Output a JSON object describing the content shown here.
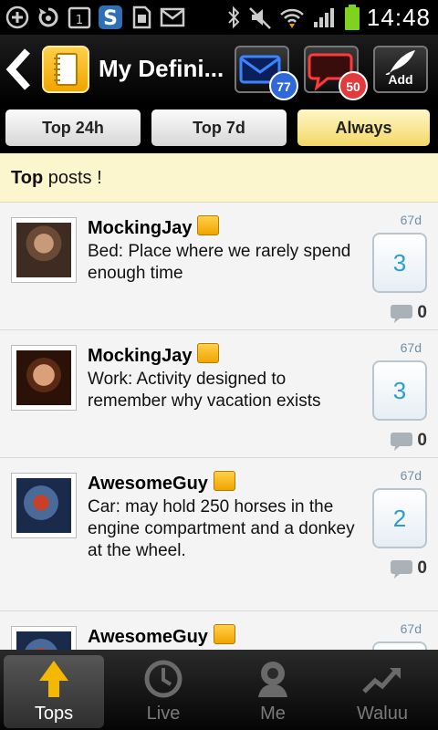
{
  "status_bar": {
    "time": "14:48",
    "icons": [
      "add-icon",
      "sync-icon",
      "calendar-icon",
      "swype-icon",
      "sim-card-icon",
      "gmail-icon",
      "bluetooth-icon",
      "mute-icon",
      "wifi-icon",
      "signal-icon",
      "battery-icon"
    ],
    "calendar_day": "1",
    "battery_color": "#7ed321"
  },
  "action_bar": {
    "title": "My Defini...",
    "messages_count": "77",
    "chat_count": "50",
    "add_label": "Add"
  },
  "tabs": [
    {
      "label": "Top 24h",
      "selected": false
    },
    {
      "label": "Top 7d",
      "selected": false
    },
    {
      "label": "Always",
      "selected": true
    }
  ],
  "header": {
    "strong": "Top",
    "rest": " posts !"
  },
  "posts": [
    {
      "author": "MockingJay",
      "text": "Bed: Place where we rarely spend enough time",
      "age": "67d",
      "votes": "3",
      "comments": "0"
    },
    {
      "author": "MockingJay",
      "text": "Work: Activity designed to remember why vacation exists",
      "age": "67d",
      "votes": "3",
      "comments": "0"
    },
    {
      "author": "AwesomeGuy",
      "text": "Car: may hold 250 horses in the engine compartment and a donkey at the wheel.",
      "age": "67d",
      "votes": "2",
      "comments": "0"
    },
    {
      "author": "AwesomeGuy",
      "text": "",
      "age": "67d",
      "votes": "",
      "comments": ""
    }
  ],
  "bottom_nav": [
    {
      "label": "Tops",
      "icon": "arrow-up-icon",
      "active": true
    },
    {
      "label": "Live",
      "icon": "clock-icon",
      "active": false
    },
    {
      "label": "Me",
      "icon": "user-icon",
      "active": false
    },
    {
      "label": "Waluu",
      "icon": "trend-icon",
      "active": false
    }
  ],
  "colors": {
    "accent": "#f0a400",
    "vote_text": "#2b9bd8",
    "header_bg": "#fcf6cf",
    "badge_blue": "#2f69d8",
    "badge_red": "#e23b3b"
  }
}
